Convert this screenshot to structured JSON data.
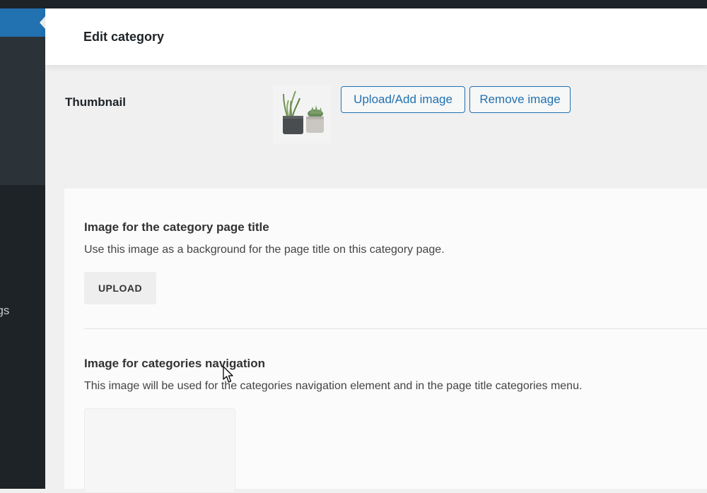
{
  "header": {
    "title": "Edit category"
  },
  "sidebar": {
    "visible_label": "ngs"
  },
  "thumbnail": {
    "label": "Thumbnail",
    "upload_add_label": "Upload/Add image",
    "remove_label": "Remove image"
  },
  "page_title_image": {
    "heading": "Image for the category page title",
    "description": "Use this image as a background for the page title on this category page.",
    "upload_label": "UPLOAD"
  },
  "nav_image": {
    "heading": "Image for categories navigation",
    "description": "This image will be used for the categories navigation element and in the page title categories menu."
  },
  "colors": {
    "admin_dark": "#1d2327",
    "admin_blue": "#2271b1",
    "page_bg": "#f0f0f1"
  },
  "icons": [
    "plant-pots-thumbnail",
    "mouse-cursor-icon"
  ]
}
